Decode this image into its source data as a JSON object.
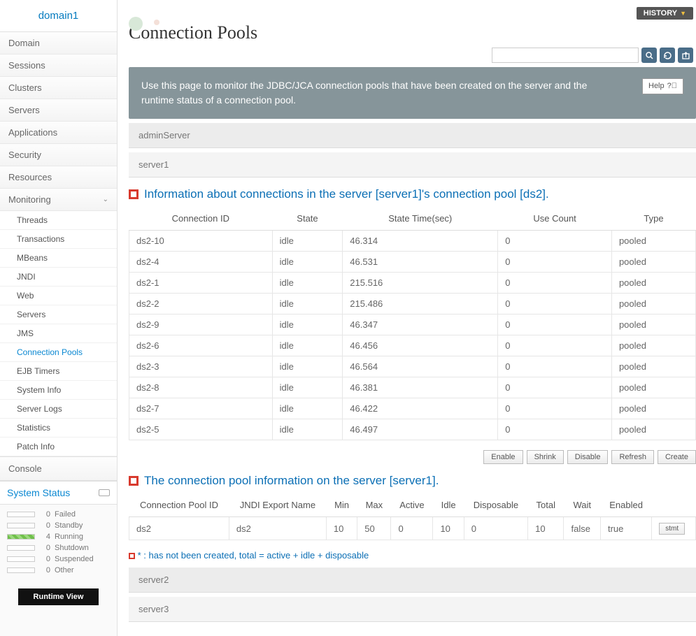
{
  "sidebar": {
    "domain": "domain1",
    "nav": [
      "Domain",
      "Sessions",
      "Clusters",
      "Servers",
      "Applications",
      "Security",
      "Resources"
    ],
    "monitoring_label": "Monitoring",
    "monitoring_items": [
      "Threads",
      "Transactions",
      "MBeans",
      "JNDI",
      "Web",
      "Servers",
      "JMS",
      "Connection Pools",
      "EJB Timers",
      "System Info",
      "Server Logs",
      "Statistics",
      "Patch Info"
    ],
    "monitoring_active": "Connection Pools",
    "console_label": "Console",
    "status_title": "System Status",
    "status_items": [
      {
        "count": 0,
        "label": "Failed",
        "filled": false
      },
      {
        "count": 0,
        "label": "Standby",
        "filled": false
      },
      {
        "count": 4,
        "label": "Running",
        "filled": true
      },
      {
        "count": 0,
        "label": "Shutdown",
        "filled": false
      },
      {
        "count": 0,
        "label": "Suspended",
        "filled": false
      },
      {
        "count": 0,
        "label": "Other",
        "filled": false
      }
    ],
    "runtime_button": "Runtime View"
  },
  "header": {
    "history_label": "HISTORY",
    "page_title": "Connection Pools",
    "search_placeholder": "",
    "tool_icons": [
      "search",
      "refresh",
      "export"
    ]
  },
  "banner": {
    "text": "Use this page to monitor the JDBC/JCA connection pools that have been created on the server and the runtime status of a connection pool.",
    "help_label": "Help"
  },
  "servers_top": [
    "adminServer",
    "server1"
  ],
  "section1": {
    "title": "Information about connections in the server [server1]'s connection pool [ds2].",
    "columns": [
      "Connection ID",
      "State",
      "State Time(sec)",
      "Use Count",
      "Type"
    ],
    "rows": [
      {
        "id": "ds2-10",
        "state": "idle",
        "time": "46.314",
        "count": "0",
        "type": "pooled"
      },
      {
        "id": "ds2-4",
        "state": "idle",
        "time": "46.531",
        "count": "0",
        "type": "pooled"
      },
      {
        "id": "ds2-1",
        "state": "idle",
        "time": "215.516",
        "count": "0",
        "type": "pooled"
      },
      {
        "id": "ds2-2",
        "state": "idle",
        "time": "215.486",
        "count": "0",
        "type": "pooled"
      },
      {
        "id": "ds2-9",
        "state": "idle",
        "time": "46.347",
        "count": "0",
        "type": "pooled"
      },
      {
        "id": "ds2-6",
        "state": "idle",
        "time": "46.456",
        "count": "0",
        "type": "pooled"
      },
      {
        "id": "ds2-3",
        "state": "idle",
        "time": "46.564",
        "count": "0",
        "type": "pooled"
      },
      {
        "id": "ds2-8",
        "state": "idle",
        "time": "46.381",
        "count": "0",
        "type": "pooled"
      },
      {
        "id": "ds2-7",
        "state": "idle",
        "time": "46.422",
        "count": "0",
        "type": "pooled"
      },
      {
        "id": "ds2-5",
        "state": "idle",
        "time": "46.497",
        "count": "0",
        "type": "pooled"
      }
    ]
  },
  "actions": [
    "Enable",
    "Shrink",
    "Disable",
    "Refresh",
    "Create"
  ],
  "section2": {
    "title": "The connection pool information on the server [server1].",
    "columns": [
      "Connection Pool ID",
      "JNDI Export Name",
      "Min",
      "Max",
      "Active",
      "Idle",
      "Disposable",
      "Total",
      "Wait",
      "Enabled",
      ""
    ],
    "rows": [
      {
        "id": "ds2",
        "jndi": "ds2",
        "min": "10",
        "max": "50",
        "active": "0",
        "idle": "10",
        "disposable": "0",
        "total": "10",
        "wait": "false",
        "enabled": "true",
        "btn": "stmt"
      }
    ]
  },
  "footnote": "* : has not been created, total = active + idle + disposable",
  "servers_bottom": [
    "server2",
    "server3"
  ]
}
